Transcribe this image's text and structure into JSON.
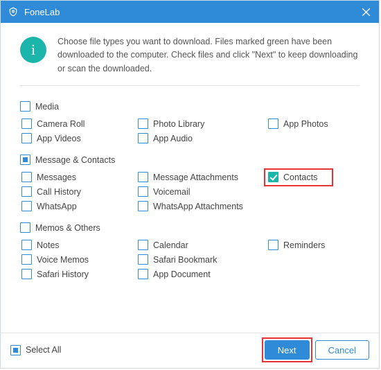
{
  "titlebar": {
    "app_name": "FoneLab"
  },
  "instructions": "Choose file types you want to download. Files marked green have been downloaded to the computer. Check files and click \"Next\" to keep downloading or scan the downloaded.",
  "sections": {
    "media": {
      "title": "Media",
      "items": {
        "camera_roll": "Camera Roll",
        "photo_library": "Photo Library",
        "app_photos": "App Photos",
        "app_videos": "App Videos",
        "app_audio": "App Audio"
      }
    },
    "msgcontacts": {
      "title": "Message & Contacts",
      "items": {
        "messages": "Messages",
        "msg_attachments": "Message Attachments",
        "contacts": "Contacts",
        "call_history": "Call History",
        "voicemail": "Voicemail",
        "whatsapp": "WhatsApp",
        "whatsapp_attachments": "WhatsApp Attachments"
      }
    },
    "memos": {
      "title": "Memos & Others",
      "items": {
        "notes": "Notes",
        "calendar": "Calendar",
        "reminders": "Reminders",
        "voice_memos": "Voice Memos",
        "safari_bookmark": "Safari Bookmark",
        "safari_history": "Safari History",
        "app_document": "App Document"
      }
    }
  },
  "footer": {
    "select_all": "Select All",
    "next": "Next",
    "cancel": "Cancel"
  }
}
